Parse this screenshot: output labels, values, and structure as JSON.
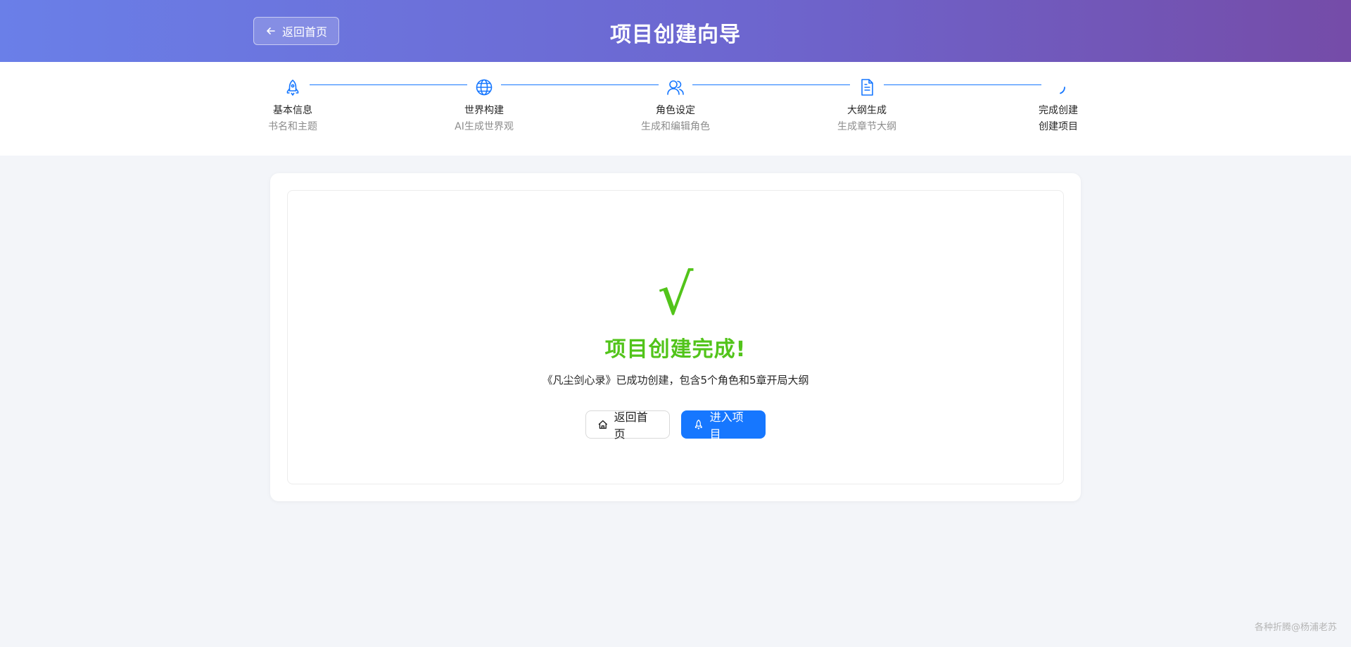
{
  "header": {
    "back_label": "返回首页",
    "title": "项目创建向导",
    "gradient": [
      "#6a7fe8",
      "#754ca8"
    ]
  },
  "steps": [
    {
      "title": "基本信息",
      "desc": "书名和主题",
      "icon": "rocket-icon",
      "status": "finished"
    },
    {
      "title": "世界构建",
      "desc": "AI生成世界观",
      "icon": "globe-icon",
      "status": "finished"
    },
    {
      "title": "角色设定",
      "desc": "生成和编辑角色",
      "icon": "users-icon",
      "status": "finished"
    },
    {
      "title": "大纲生成",
      "desc": "生成章节大纲",
      "icon": "file-text-icon",
      "status": "finished"
    },
    {
      "title": "完成创建",
      "desc": "创建项目",
      "icon": "loading-icon",
      "status": "process"
    }
  ],
  "result": {
    "icon": "check-icon",
    "icon_glyph": "√",
    "title": "项目创建完成!",
    "description": "《凡尘剑心录》已成功创建，包含5个角色和5章开局大纲",
    "success_color": "#52c41a"
  },
  "actions": {
    "home_label": "返回首页",
    "enter_label": "进入项目",
    "primary_color": "#1677ff"
  },
  "watermark": "各种折腾@杨浦老苏"
}
